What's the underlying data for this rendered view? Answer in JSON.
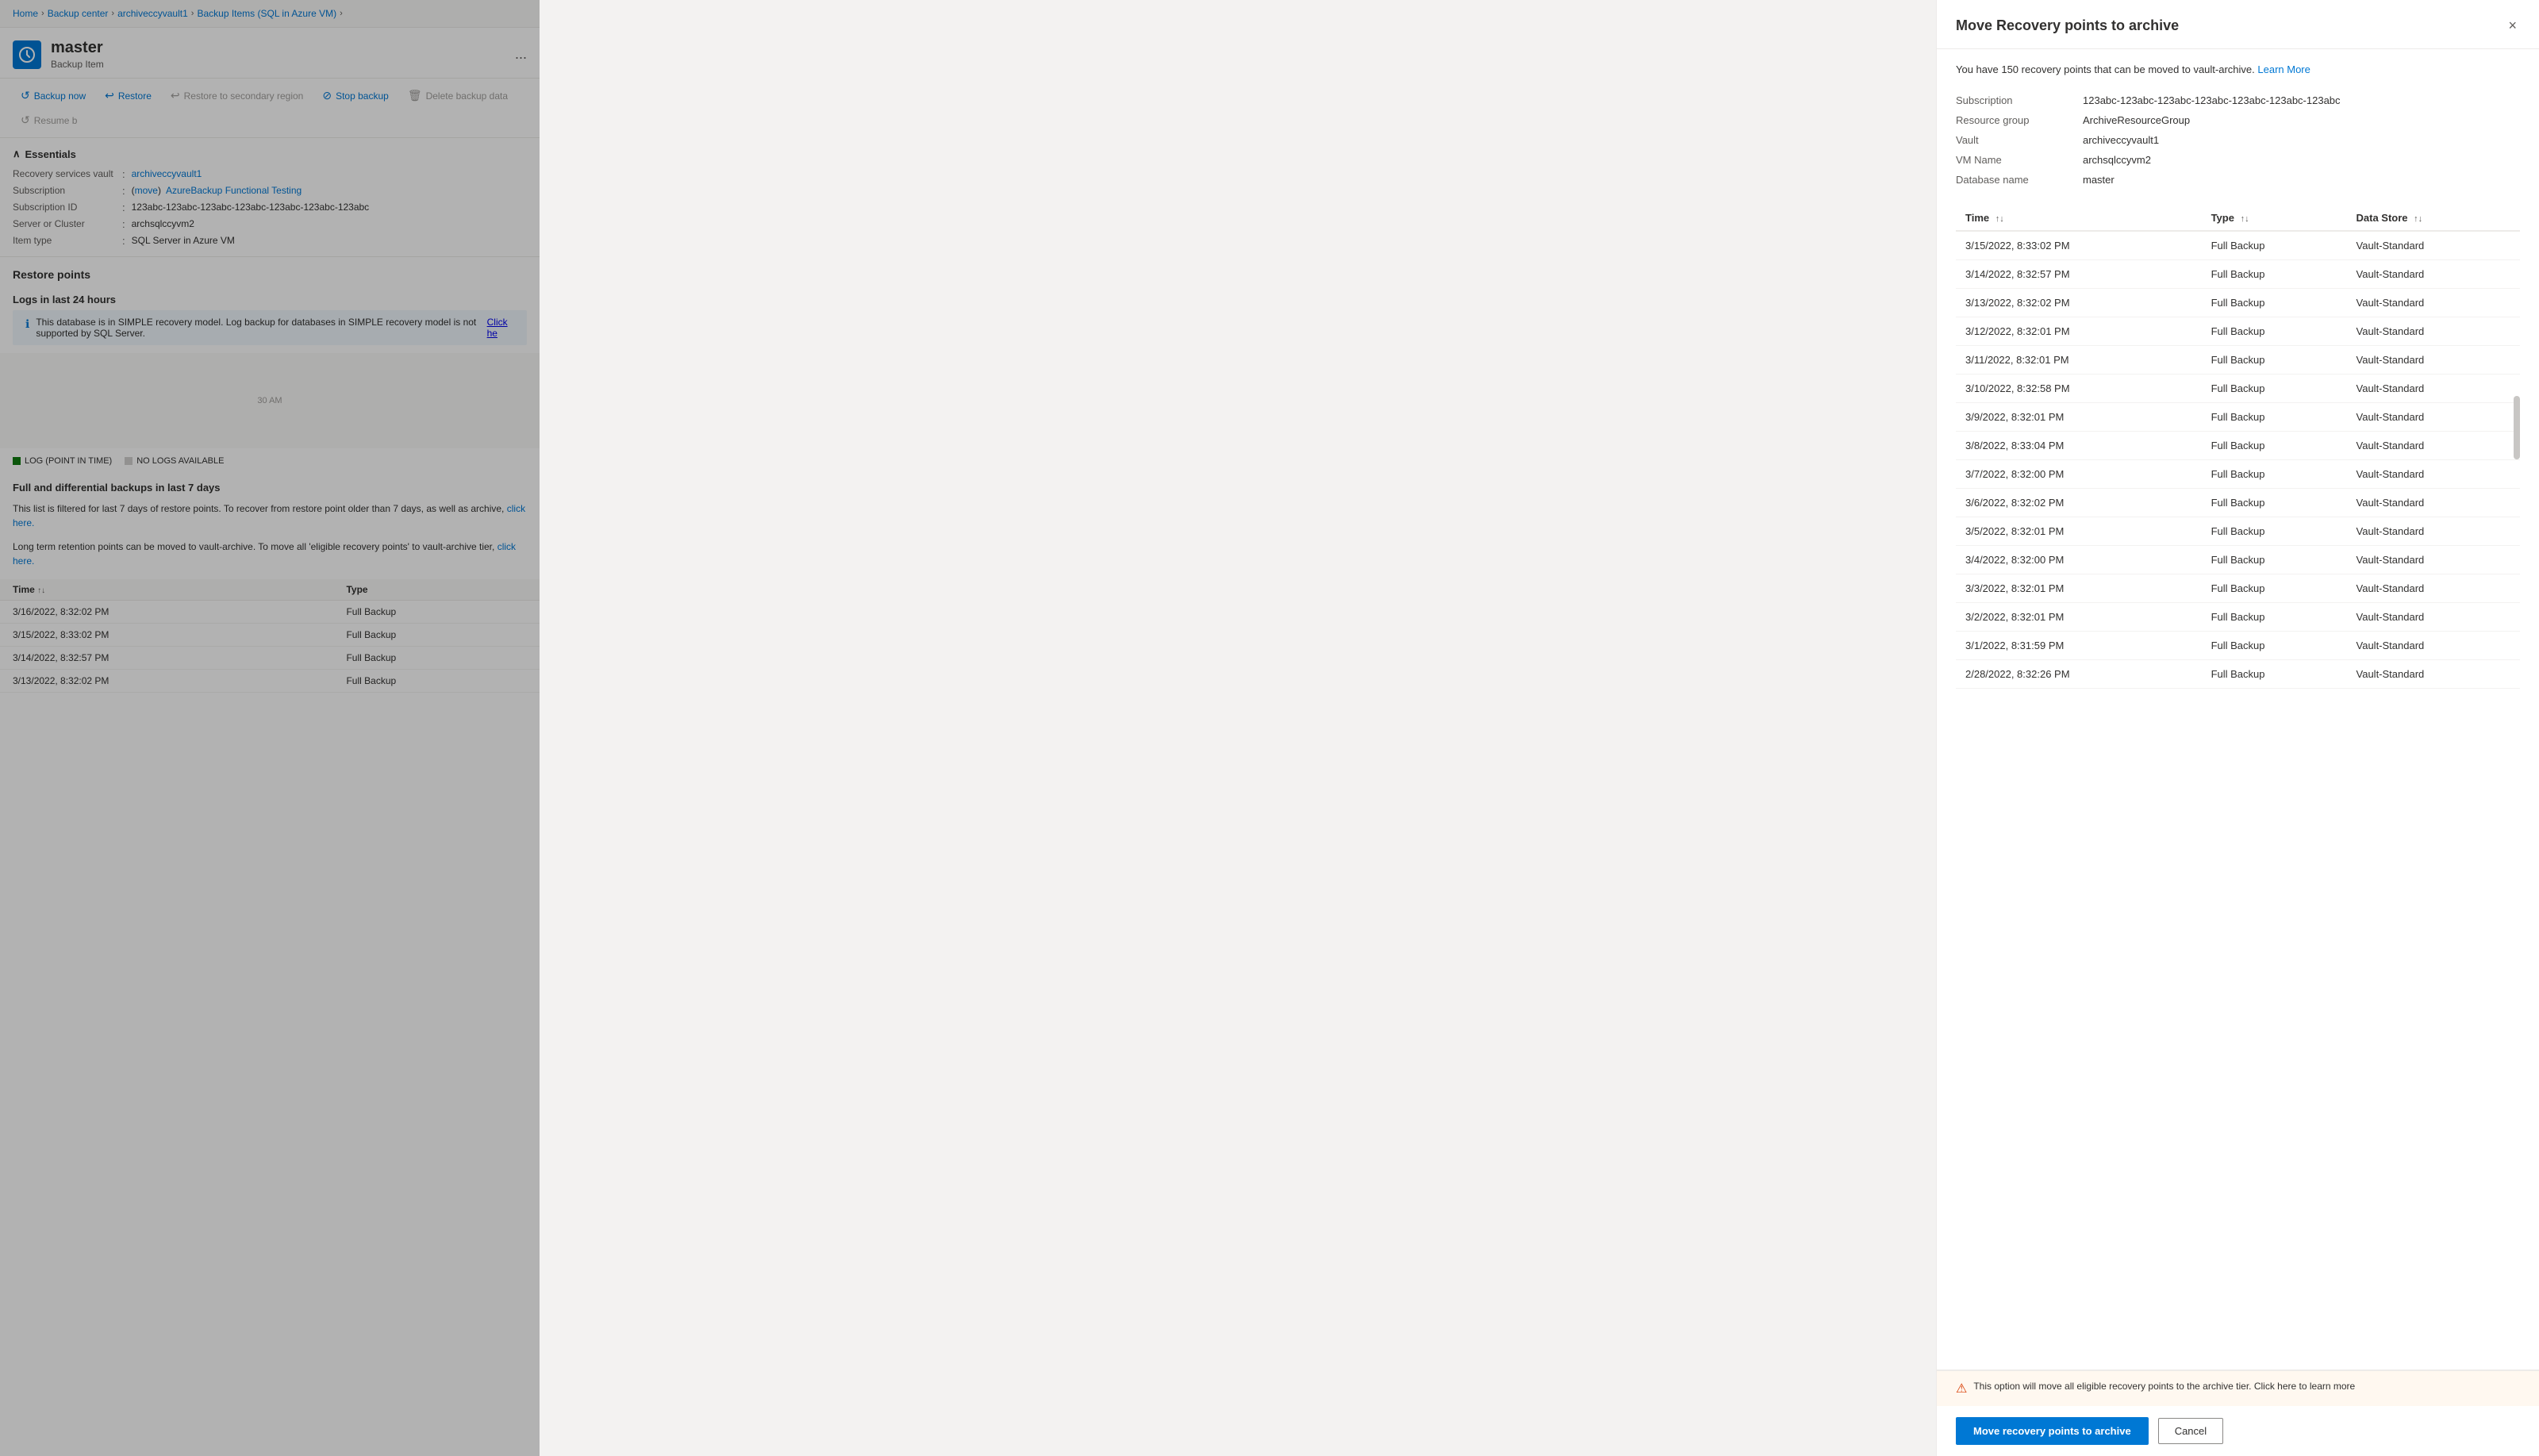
{
  "breadcrumb": {
    "items": [
      "Home",
      "Backup center",
      "archiveccyvault1",
      "Backup Items (SQL in Azure VM)"
    ],
    "separators": [
      ">",
      ">",
      ">",
      ">"
    ]
  },
  "item": {
    "name": "master",
    "subtitle": "Backup Item",
    "more_label": "..."
  },
  "toolbar": {
    "buttons": [
      {
        "id": "backup-now",
        "label": "Backup now",
        "icon": "↺"
      },
      {
        "id": "restore",
        "label": "Restore",
        "icon": "↩"
      },
      {
        "id": "restore-secondary",
        "label": "Restore to secondary region",
        "icon": "↩"
      },
      {
        "id": "stop-backup",
        "label": "Stop backup",
        "icon": "⊘"
      },
      {
        "id": "delete-backup",
        "label": "Delete backup data",
        "icon": "🗑"
      },
      {
        "id": "resume-backup",
        "label": "Resume b",
        "icon": "↺"
      }
    ]
  },
  "essentials": {
    "title": "Essentials",
    "fields": [
      {
        "label": "Recovery services vault",
        "value": "archiveccyvault1",
        "link": true
      },
      {
        "label": "Subscription",
        "value": "AzureBackup Functional Testing",
        "link": true,
        "has_move": true
      },
      {
        "label": "Subscription ID",
        "value": "123abc-123abc-123abc-123abc-123abc-123abc-123abc"
      },
      {
        "label": "Server or Cluster",
        "value": "archsqlccyvm2"
      },
      {
        "label": "Item type",
        "value": "SQL Server in Azure VM"
      }
    ]
  },
  "sections": {
    "restore_points": "Restore points",
    "logs_24h": "Logs in last 24 hours",
    "full_diff": "Full and differential backups in last 7 days"
  },
  "info_message": "This database is in SIMPLE recovery model. Log backup for databases in SIMPLE recovery model is not supported by SQL Server.",
  "click_here": "Click he",
  "para_7days": "This list is filtered for last 7 days of restore points. To recover from restore point older than 7 days, as well as archive,",
  "para_archive": "Long term retention points can be moved to vault-archive. To move all 'eligible recovery points' to vault-archive tier,",
  "chart_label_30am": "30 AM",
  "log_labels": [
    {
      "label": "LOG (POINT IN TIME)",
      "color": "green"
    },
    {
      "label": "NO LOGS AVAILABLE",
      "color": "gray"
    }
  ],
  "backup_table": {
    "columns": [
      "Time",
      "Type"
    ],
    "rows": [
      {
        "time": "3/16/2022, 8:32:02 PM",
        "type": "Full Backup"
      },
      {
        "time": "3/15/2022, 8:33:02 PM",
        "type": "Full Backup"
      },
      {
        "time": "3/14/2022, 8:32:57 PM",
        "type": "Full Backup"
      },
      {
        "time": "3/13/2022, 8:32:02 PM",
        "type": "Full Backup"
      }
    ]
  },
  "modal": {
    "title": "Move Recovery points to archive",
    "close_label": "×",
    "description": "You have 150 recovery points that can be moved to vault-archive.",
    "learn_more": "Learn More",
    "info_fields": [
      {
        "label": "Subscription",
        "value": "123abc-123abc-123abc-123abc-123abc-123abc-123abc"
      },
      {
        "label": "Resource group",
        "value": "ArchiveResourceGroup"
      },
      {
        "label": "Vault",
        "value": "archiveccyvault1"
      },
      {
        "label": "VM Name",
        "value": "archsqlccyvm2"
      },
      {
        "label": "Database name",
        "value": "master"
      }
    ],
    "table": {
      "columns": [
        {
          "label": "Time",
          "sortable": true
        },
        {
          "label": "Type",
          "sortable": true
        },
        {
          "label": "Data Store",
          "sortable": true
        }
      ],
      "rows": [
        {
          "time": "3/15/2022, 8:33:02 PM",
          "type": "Full Backup",
          "store": "Vault-Standard"
        },
        {
          "time": "3/14/2022, 8:32:57 PM",
          "type": "Full Backup",
          "store": "Vault-Standard"
        },
        {
          "time": "3/13/2022, 8:32:02 PM",
          "type": "Full Backup",
          "store": "Vault-Standard"
        },
        {
          "time": "3/12/2022, 8:32:01 PM",
          "type": "Full Backup",
          "store": "Vault-Standard"
        },
        {
          "time": "3/11/2022, 8:32:01 PM",
          "type": "Full Backup",
          "store": "Vault-Standard"
        },
        {
          "time": "3/10/2022, 8:32:58 PM",
          "type": "Full Backup",
          "store": "Vault-Standard"
        },
        {
          "time": "3/9/2022, 8:32:01 PM",
          "type": "Full Backup",
          "store": "Vault-Standard"
        },
        {
          "time": "3/8/2022, 8:33:04 PM",
          "type": "Full Backup",
          "store": "Vault-Standard"
        },
        {
          "time": "3/7/2022, 8:32:00 PM",
          "type": "Full Backup",
          "store": "Vault-Standard"
        },
        {
          "time": "3/6/2022, 8:32:02 PM",
          "type": "Full Backup",
          "store": "Vault-Standard"
        },
        {
          "time": "3/5/2022, 8:32:01 PM",
          "type": "Full Backup",
          "store": "Vault-Standard"
        },
        {
          "time": "3/4/2022, 8:32:00 PM",
          "type": "Full Backup",
          "store": "Vault-Standard"
        },
        {
          "time": "3/3/2022, 8:32:01 PM",
          "type": "Full Backup",
          "store": "Vault-Standard"
        },
        {
          "time": "3/2/2022, 8:32:01 PM",
          "type": "Full Backup",
          "store": "Vault-Standard"
        },
        {
          "time": "3/1/2022, 8:31:59 PM",
          "type": "Full Backup",
          "store": "Vault-Standard"
        },
        {
          "time": "2/28/2022, 8:32:26 PM",
          "type": "Full Backup",
          "store": "Vault-Standard"
        }
      ]
    },
    "warning_text": "This option will move all eligible recovery points to the archive tier. Click here to learn more",
    "move_button": "Move recovery points to archive",
    "cancel_button": "Cancel"
  }
}
